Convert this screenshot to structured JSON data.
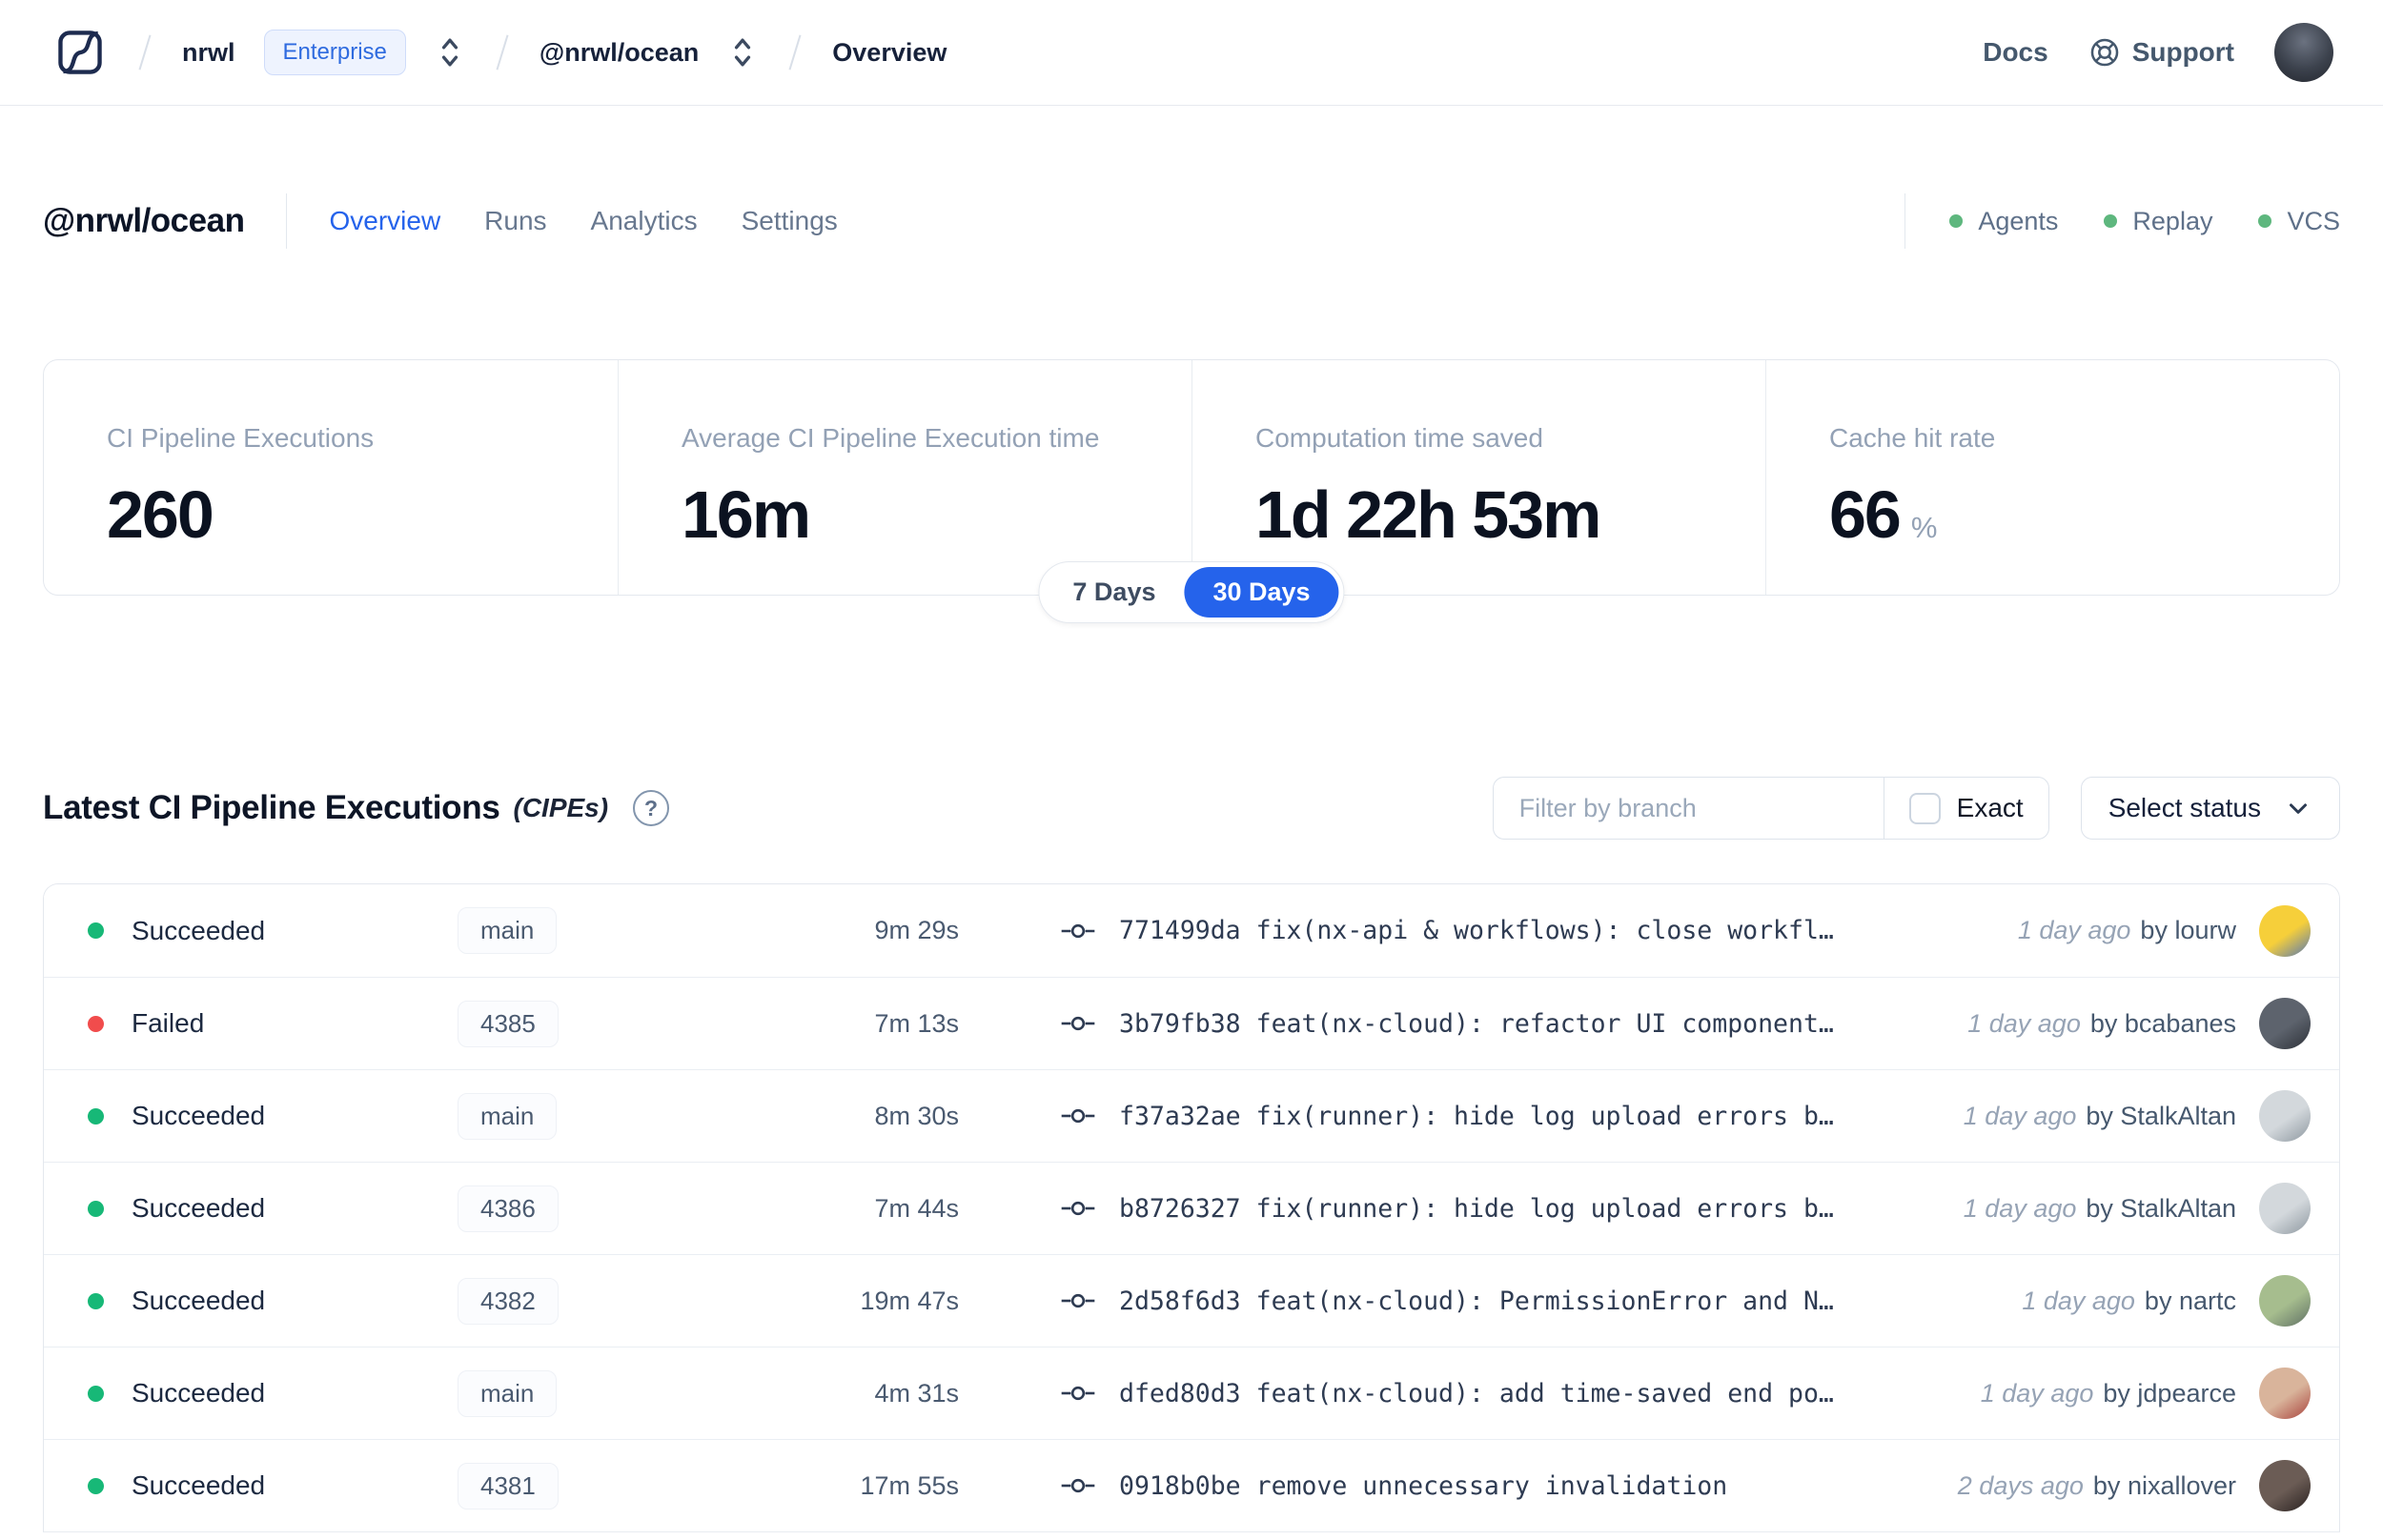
{
  "nav": {
    "breadcrumb": {
      "org": "nrwl",
      "org_badge": "Enterprise",
      "workspace": "@nrwl/ocean",
      "page": "Overview"
    },
    "docs_label": "Docs",
    "support_label": "Support"
  },
  "workspace_header": {
    "title": "@nrwl/ocean",
    "tabs": [
      {
        "label": "Overview",
        "active": true
      },
      {
        "label": "Runs",
        "active": false
      },
      {
        "label": "Analytics",
        "active": false
      },
      {
        "label": "Settings",
        "active": false
      }
    ],
    "health_items": [
      {
        "label": "Agents",
        "color": "#5eb77e"
      },
      {
        "label": "Replay",
        "color": "#5eb77e"
      },
      {
        "label": "VCS",
        "color": "#5eb77e"
      }
    ]
  },
  "stats": {
    "cards": [
      {
        "label": "CI Pipeline Executions",
        "value": "260",
        "suffix": ""
      },
      {
        "label": "Average CI Pipeline Execution time",
        "value": "16m",
        "suffix": ""
      },
      {
        "label": "Computation time saved",
        "value": "1d 22h 53m",
        "suffix": ""
      },
      {
        "label": "Cache hit rate",
        "value": "66",
        "suffix": "%"
      }
    ],
    "range_toggle": {
      "options": [
        "7 Days",
        "30 Days"
      ],
      "selected": "30 Days"
    }
  },
  "cipe_section": {
    "title": "Latest CI Pipeline Executions",
    "subtitle": "(CIPEs)",
    "help_icon": "?",
    "filter_placeholder": "Filter by branch",
    "exact_label": "Exact",
    "status_select_label": "Select status",
    "by_label": "by",
    "rows": [
      {
        "status": "Succeeded",
        "status_color": "#17b877",
        "branch": "main",
        "duration": "9m 29s",
        "commit_sha": "771499da",
        "commit_message": "fix(nx-api & workflows): close workfl…",
        "time_ago": "1 day ago",
        "author": "lourw",
        "avatar_colors": [
          "#f6cf3a",
          "#5577b5"
        ]
      },
      {
        "status": "Failed",
        "status_color": "#f14c4c",
        "branch": "4385",
        "duration": "7m 13s",
        "commit_sha": "3b79fb38",
        "commit_message": "feat(nx-cloud): refactor UI component…",
        "time_ago": "1 day ago",
        "author": "bcabanes",
        "avatar_colors": [
          "#5d636d",
          "#2d3138"
        ]
      },
      {
        "status": "Succeeded",
        "status_color": "#17b877",
        "branch": "main",
        "duration": "8m 30s",
        "commit_sha": "f37a32ae",
        "commit_message": "fix(runner): hide log upload errors b…",
        "time_ago": "1 day ago",
        "author": "StalkAltan",
        "avatar_colors": [
          "#d3d8dc",
          "#8d979f"
        ]
      },
      {
        "status": "Succeeded",
        "status_color": "#17b877",
        "branch": "4386",
        "duration": "7m 44s",
        "commit_sha": "b8726327",
        "commit_message": "fix(runner): hide log upload errors b…",
        "time_ago": "1 day ago",
        "author": "StalkAltan",
        "avatar_colors": [
          "#d3d8dc",
          "#8d979f"
        ]
      },
      {
        "status": "Succeeded",
        "status_color": "#17b877",
        "branch": "4382",
        "duration": "19m 47s",
        "commit_sha": "2d58f6d3",
        "commit_message": "feat(nx-cloud): PermissionError and N…",
        "time_ago": "1 day ago",
        "author": "nartc",
        "avatar_colors": [
          "#a6bd8e",
          "#5f7064"
        ]
      },
      {
        "status": "Succeeded",
        "status_color": "#17b877",
        "branch": "main",
        "duration": "4m 31s",
        "commit_sha": "dfed80d3",
        "commit_message": "feat(nx-cloud): add time-saved end po…",
        "time_ago": "1 day ago",
        "author": "jdpearce",
        "avatar_colors": [
          "#d9b49b",
          "#a8423c"
        ]
      },
      {
        "status": "Succeeded",
        "status_color": "#17b877",
        "branch": "4381",
        "duration": "17m 55s",
        "commit_sha": "0918b0be",
        "commit_message": "remove unnecessary invalidation",
        "time_ago": "2 days ago",
        "author": "nixallover",
        "avatar_colors": [
          "#6b5c55",
          "#292120"
        ]
      }
    ]
  },
  "colors": {
    "accent_blue": "#2563eb",
    "success_green": "#17b877",
    "failed_red": "#f14c4c",
    "health_green": "#5eb77e",
    "border": "#e4e8ee",
    "muted_text": "#93a1b5"
  }
}
